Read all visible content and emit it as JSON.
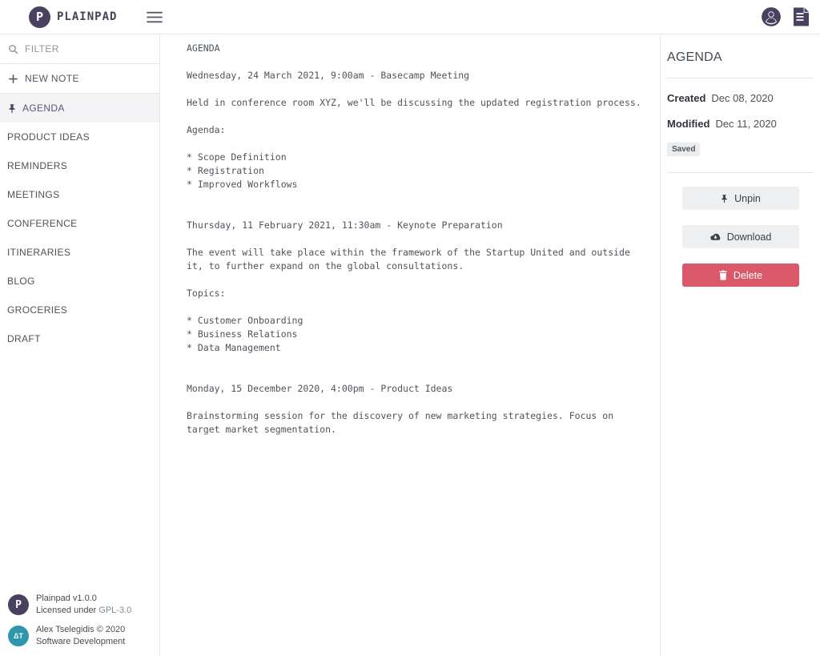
{
  "topbar": {
    "brand": "PLAINPAD",
    "logo_letter": "P"
  },
  "sidebar": {
    "filter_placeholder": "FILTER",
    "new_note_label": "NEW NOTE",
    "notes": [
      {
        "label": "AGENDA",
        "pinned": true,
        "active": true
      },
      {
        "label": "PRODUCT IDEAS"
      },
      {
        "label": "REMINDERS"
      },
      {
        "label": "MEETINGS"
      },
      {
        "label": "CONFERENCE"
      },
      {
        "label": "ITINERARIES"
      },
      {
        "label": "BLOG"
      },
      {
        "label": "GROCERIES"
      },
      {
        "label": "DRAFT"
      }
    ],
    "footer": {
      "app_name": "Plainpad",
      "app_version": "v1.0.0",
      "license_prefix": "Licensed under ",
      "license_link": "GPL-3.0",
      "author_logo_text": "ΔT",
      "author_line": "Alex Tselegidis © 2020",
      "author_role": "Software Development"
    }
  },
  "editor": {
    "content": "AGENDA\n\nWednesday, 24 March 2021, 9:00am - Basecamp Meeting\n\nHeld in conference room XYZ, we'll be discussing the updated registration process.\n\nAgenda:\n\n* Scope Definition\n* Registration\n* Improved Workflows\n\n\nThursday, 11 February 2021, 11:30am - Keynote Preparation\n\nThe event will take place within the framework of the Startup United and outside\nit, to further expand on the global consultations.\n\nTopics:\n\n* Customer Onboarding\n* Business Relations\n* Data Management\n\n\nMonday, 15 December 2020, 4:00pm - Product Ideas\n\nBrainstorming session for the discovery of new marketing strategies. Focus on\ntarget market segmentation."
  },
  "details": {
    "title": "AGENDA",
    "created_label": "Created",
    "created_value": "Dec 08, 2020",
    "modified_label": "Modified",
    "modified_value": "Dec 11, 2020",
    "status_badge": "Saved",
    "unpin_label": "Unpin",
    "download_label": "Download",
    "delete_label": "Delete"
  },
  "colors": {
    "brand_purple": "#4a4161",
    "accent_teal": "#3096ad",
    "danger_red": "#d9586a",
    "active_item_bg": "#f4f4f6",
    "border": "#e5e7ea"
  }
}
